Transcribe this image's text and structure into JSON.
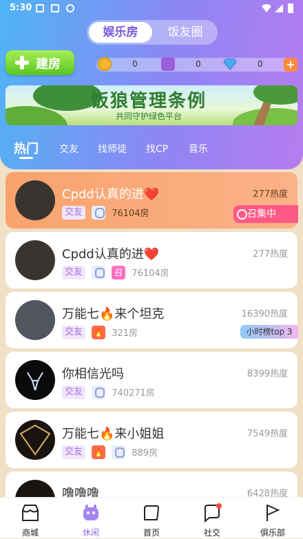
{
  "status": {
    "time": "5:30"
  },
  "segment": {
    "active": "娱乐房",
    "other": "饭友圈"
  },
  "build_label": "建房",
  "currency": {
    "coin": "0",
    "gem": "0",
    "diamond": "0"
  },
  "banner": {
    "title": "饭狼管理条例",
    "subtitle": "共同守护绿色平台"
  },
  "tabs": [
    "热门",
    "交友",
    "找师徒",
    "找CP",
    "音乐"
  ],
  "rooms": [
    {
      "title": "Cpdd认真的进❤️",
      "heat": "277热度",
      "tag": "交友",
      "room_no": "76104房",
      "badge": "召集中"
    },
    {
      "title": "Cpdd认真的进❤️",
      "heat": "277热度",
      "tag": "交友",
      "zhao": "召",
      "room_no": "76104房"
    },
    {
      "title": "万能七🔥来个坦克",
      "heat": "16390热度",
      "tag": "交友",
      "room_no": "321房",
      "badge": "小时榜top 3"
    },
    {
      "title": "你相信光吗",
      "heat": "8399热度",
      "tag": "交友",
      "room_no": "740271房"
    },
    {
      "title": "万能七🔥来小姐姐",
      "heat": "7549热度",
      "tag": "交友",
      "room_no": "889房"
    },
    {
      "title": "噜噜噜",
      "heat": "6428热度"
    }
  ],
  "nav": [
    "商城",
    "休闲",
    "首页",
    "社交",
    "俱乐部"
  ],
  "colors": {
    "header_start": "#4fb4f5",
    "header_end": "#b77cf0",
    "accent": "#8b67e8",
    "build_green": "#5ac623",
    "gather_pink": "#ff5a86"
  }
}
